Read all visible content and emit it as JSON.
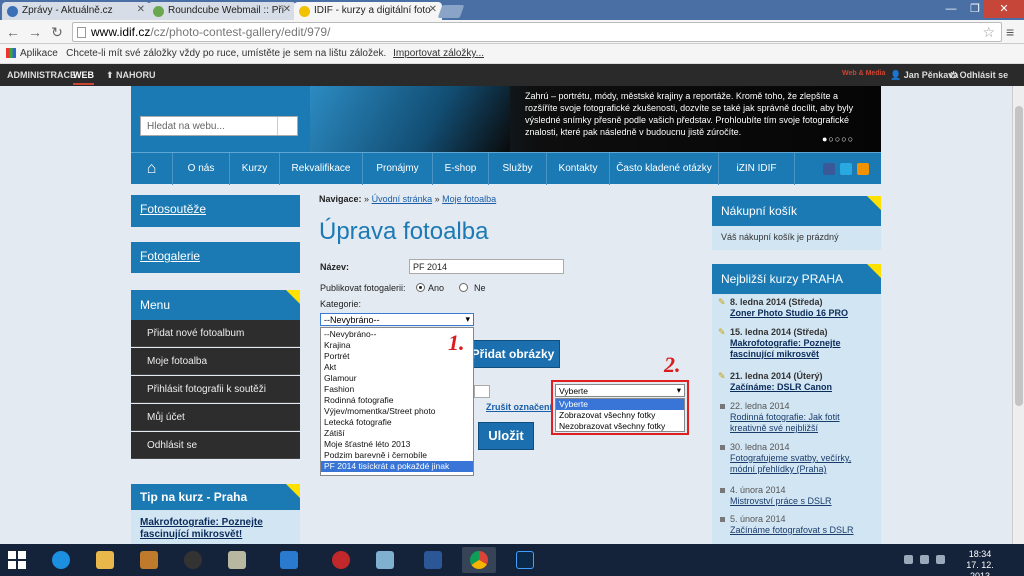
{
  "browser": {
    "tabs": [
      {
        "title": "Zprávy - Aktuálně.cz"
      },
      {
        "title": "Roundcube Webmail :: Při"
      },
      {
        "title": "IDIF - kurzy a digitální foto"
      }
    ],
    "url_domain": "www.idif.cz",
    "url_path": "/cz/photo-contest-gallery/edit/979/",
    "bookmarks_apps": "Aplikace",
    "bookmarks_hint": "Chcete-li mít své záložky vždy po ruce, umístěte je sem na lištu záložek.",
    "bookmarks_import": "Importovat záložky..."
  },
  "adminbar": {
    "admin": "ADMINISTRACE",
    "web": "WEB",
    "up": "NAHORU",
    "logo": "Web & Media",
    "user": "Jan Pěnkava",
    "logout": "Odhlásit se"
  },
  "header": {
    "search_placeholder": "Hledat na webu...",
    "banner_text": "Zahrú – portrétu, módy, městské krajiny a reportáže. Kromě toho, že zlepšíte a rozšíříte svoje fotografické zkušenosti, dozvíte se také jak správně docílit, aby byly výsledné snímky přesně podle vašich představ. Prohloubíte tím svoje fotografické znalosti, které pak následně v budoucnu jistě zúročíte.",
    "dots": "●○○○○"
  },
  "nav": [
    "O nás",
    "Kurzy",
    "Rekvalifikace",
    "Pronájmy",
    "E-shop",
    "Služby",
    "Kontakty",
    "Často kladené otázky",
    "iZIN IDIF"
  ],
  "left": {
    "fotosouteze": "Fotosoutěže",
    "fotogalerie": "Fotogalerie",
    "menu_title": "Menu",
    "menu": [
      "Přidat nové fotoalbum",
      "Moje fotoalba",
      "Přihlásit fotografii k soutěži",
      "Můj účet",
      "Odhlásit se"
    ],
    "tip_title": "Tip na kurz - Praha",
    "tip_link": "Makrofotografie: Poznejte fascinující mikrosvět!"
  },
  "content": {
    "crumb_label": "Navigace:",
    "crumb_sep": "»",
    "crumb_home": "Úvodní stránka",
    "crumb_albums": "Moje fotoalba",
    "title": "Úprava fotoalba",
    "name_label": "Název:",
    "name_value": "PF 2014",
    "publish_label": "Publikovat fotogalerii:",
    "yes": "Ano",
    "no": "Ne",
    "category_label": "Kategorie:",
    "category_selected": "--Nevybráno--",
    "category_options": [
      "--Nevybráno--",
      "Krajina",
      "Portrét",
      "Akt",
      "Glamour",
      "Fashion",
      "Rodinná fotografie",
      "Výjev/momentka/Street photo",
      "Letecká fotografie",
      "Zátiší",
      "Moje šťastné léto 2013",
      "Podzim barevně i černobíle",
      "PF 2014 tisíckrát a pokaždé jinak"
    ],
    "add_photos": "Přidat obrázky",
    "cancel_marking": "Zrušit označení",
    "save": "Uložit",
    "action_selected": "Vyberte",
    "action_options": [
      "Vyberte",
      "Zobrazovat všechny fotky",
      "Nezobrazovat všechny fotky"
    ],
    "annot1": "1.",
    "annot2": "2."
  },
  "right": {
    "cart_title": "Nákupní košík",
    "cart_empty": "Váš nákupní košík je prázdný",
    "courses_title": "Nejbližší kurzy PRAHA",
    "courses": [
      {
        "date": "8. ledna 2014 (Středa)",
        "title": "Zoner Photo Studio 16 PRO"
      },
      {
        "date": "15. ledna 2014 (Středa)",
        "title": "Makrofotografie: Poznejte fascinující mikrosvět"
      },
      {
        "date": "21. ledna 2014 (Úterý)",
        "title": "Začínáme: DSLR Canon"
      },
      {
        "date": "22. ledna 2014",
        "title": "Rodinná fotografie: Jak fotit kreativně své nejbližší"
      },
      {
        "date": "30. ledna 2014",
        "title": "Fotografujeme svatby, večírky, módní přehlídky (Praha)"
      },
      {
        "date": "4. února 2014",
        "title": "Mistrovství práce s DSLR"
      },
      {
        "date": "5. února 2014",
        "title": "Začínáme fotografovat s DSLR"
      }
    ]
  },
  "taskbar": {
    "time": "18:34",
    "date": "17. 12. 2013"
  }
}
